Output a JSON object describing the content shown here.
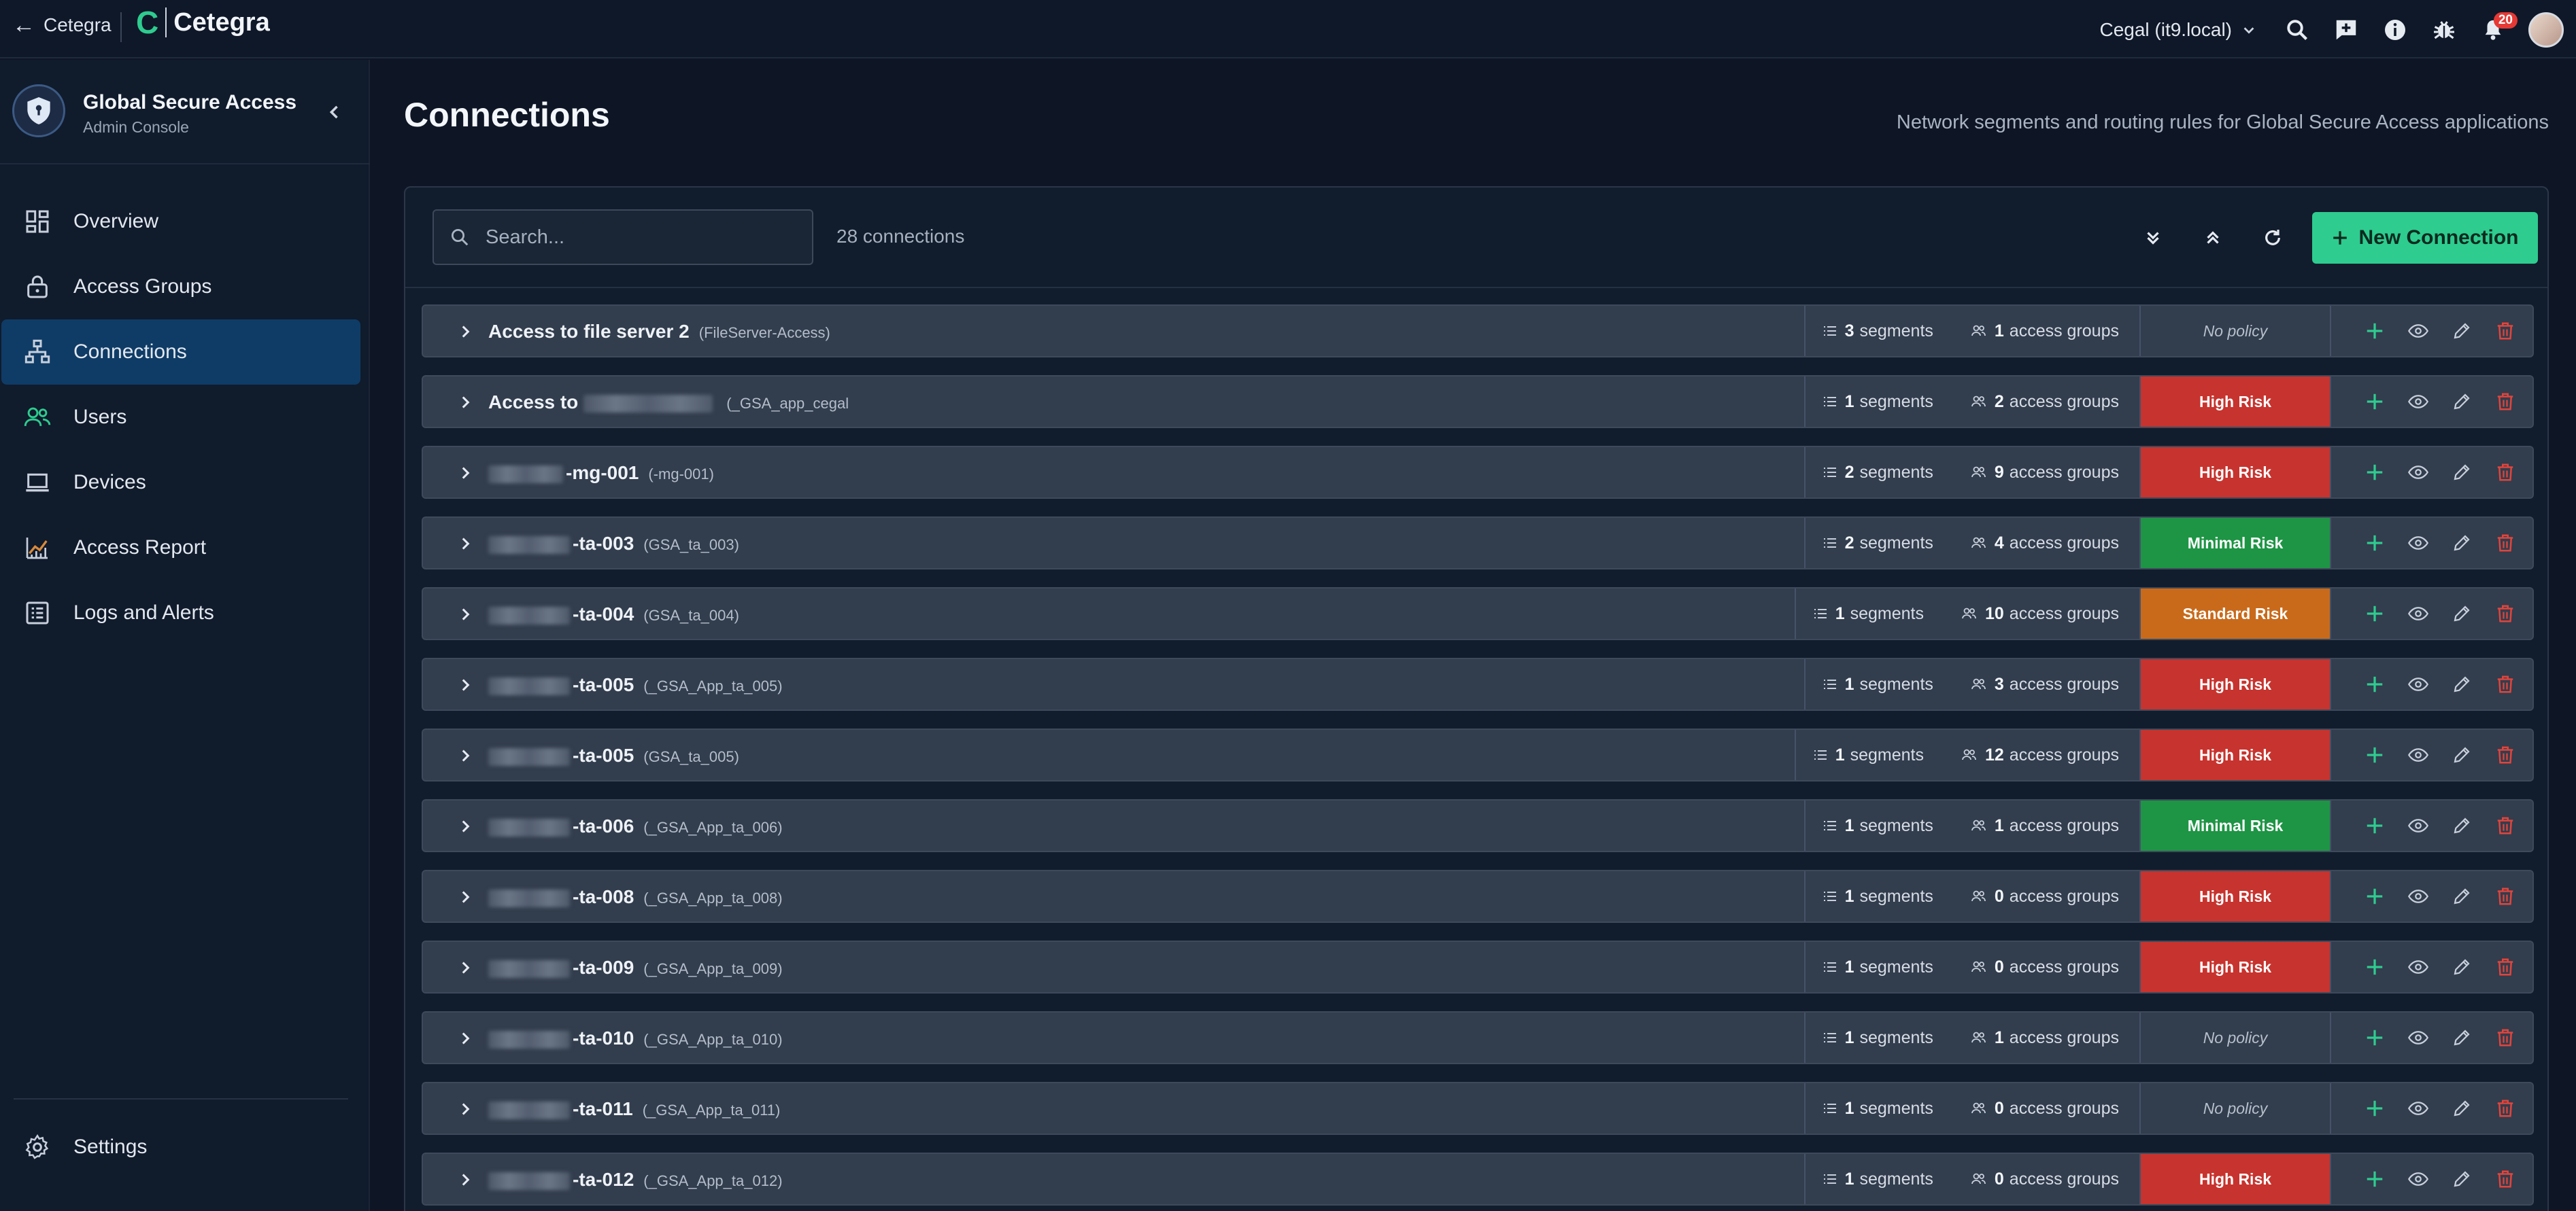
{
  "topbar": {
    "back_label": "Cetegra",
    "logo_mark": "C",
    "app_name": "Cetegra",
    "tenant": "Cegal (it9.local)",
    "notifications_count": "20"
  },
  "sidebar": {
    "title": "Global Secure Access",
    "subtitle": "Admin Console",
    "items": [
      {
        "label": "Overview",
        "icon": "dashboard-icon",
        "active": false
      },
      {
        "label": "Access Groups",
        "icon": "lock-icon",
        "active": false
      },
      {
        "label": "Connections",
        "icon": "network-icon",
        "active": true
      },
      {
        "label": "Users",
        "icon": "users-icon",
        "active": false
      },
      {
        "label": "Devices",
        "icon": "laptop-icon",
        "active": false
      },
      {
        "label": "Access Report",
        "icon": "chart-icon",
        "active": false
      },
      {
        "label": "Logs and Alerts",
        "icon": "list-icon",
        "active": false
      }
    ],
    "settings_label": "Settings"
  },
  "main": {
    "title": "Connections",
    "description": "Network segments and routing rules for Global Secure Access applications",
    "search_placeholder": "Search...",
    "count_label": "28 connections",
    "new_button_label": "New Connection",
    "segments_label": "segments",
    "groups_label": "access groups"
  },
  "colors": {
    "accent": "#2ecc8f",
    "high_risk": "#c7332e",
    "minimal_risk": "#1d9544",
    "standard_risk": "#c96a1b",
    "active_nav": "#0f3c66"
  },
  "connections": [
    {
      "name": "Access to file server 2",
      "id": "(FileServer-Access)",
      "segments": "3",
      "groups": "1",
      "risk": "No policy",
      "level": "none"
    },
    {
      "name": "Access to",
      "id": "(_GSA_app_cegal",
      "segments": "1",
      "groups": "2",
      "risk": "High Risk",
      "level": "high"
    },
    {
      "name": "-mg-001",
      "id": "(-mg-001)",
      "segments": "2",
      "groups": "9",
      "risk": "High Risk",
      "level": "high"
    },
    {
      "name": "-ta-003",
      "id": "(GSA_ta_003)",
      "segments": "2",
      "groups": "4",
      "risk": "Minimal Risk",
      "level": "min"
    },
    {
      "name": "-ta-004",
      "id": "(GSA_ta_004)",
      "segments": "1",
      "groups": "10",
      "risk": "Standard Risk",
      "level": "std"
    },
    {
      "name": "-ta-005",
      "id": "(_GSA_App_ta_005)",
      "segments": "1",
      "groups": "3",
      "risk": "High Risk",
      "level": "high"
    },
    {
      "name": "-ta-005",
      "id": "(GSA_ta_005)",
      "segments": "1",
      "groups": "12",
      "risk": "High Risk",
      "level": "high"
    },
    {
      "name": "-ta-006",
      "id": "(_GSA_App_ta_006)",
      "segments": "1",
      "groups": "1",
      "risk": "Minimal Risk",
      "level": "min"
    },
    {
      "name": "-ta-008",
      "id": "(_GSA_App_ta_008)",
      "segments": "1",
      "groups": "0",
      "risk": "High Risk",
      "level": "high"
    },
    {
      "name": "-ta-009",
      "id": "(_GSA_App_ta_009)",
      "segments": "1",
      "groups": "0",
      "risk": "High Risk",
      "level": "high"
    },
    {
      "name": "-ta-010",
      "id": "(_GSA_App_ta_010)",
      "segments": "1",
      "groups": "1",
      "risk": "No policy",
      "level": "none"
    },
    {
      "name": "-ta-011",
      "id": "(_GSA_App_ta_011)",
      "segments": "1",
      "groups": "0",
      "risk": "No policy",
      "level": "none"
    },
    {
      "name": "-ta-012",
      "id": "(_GSA_App_ta_012)",
      "segments": "1",
      "groups": "0",
      "risk": "High Risk",
      "level": "high"
    }
  ]
}
